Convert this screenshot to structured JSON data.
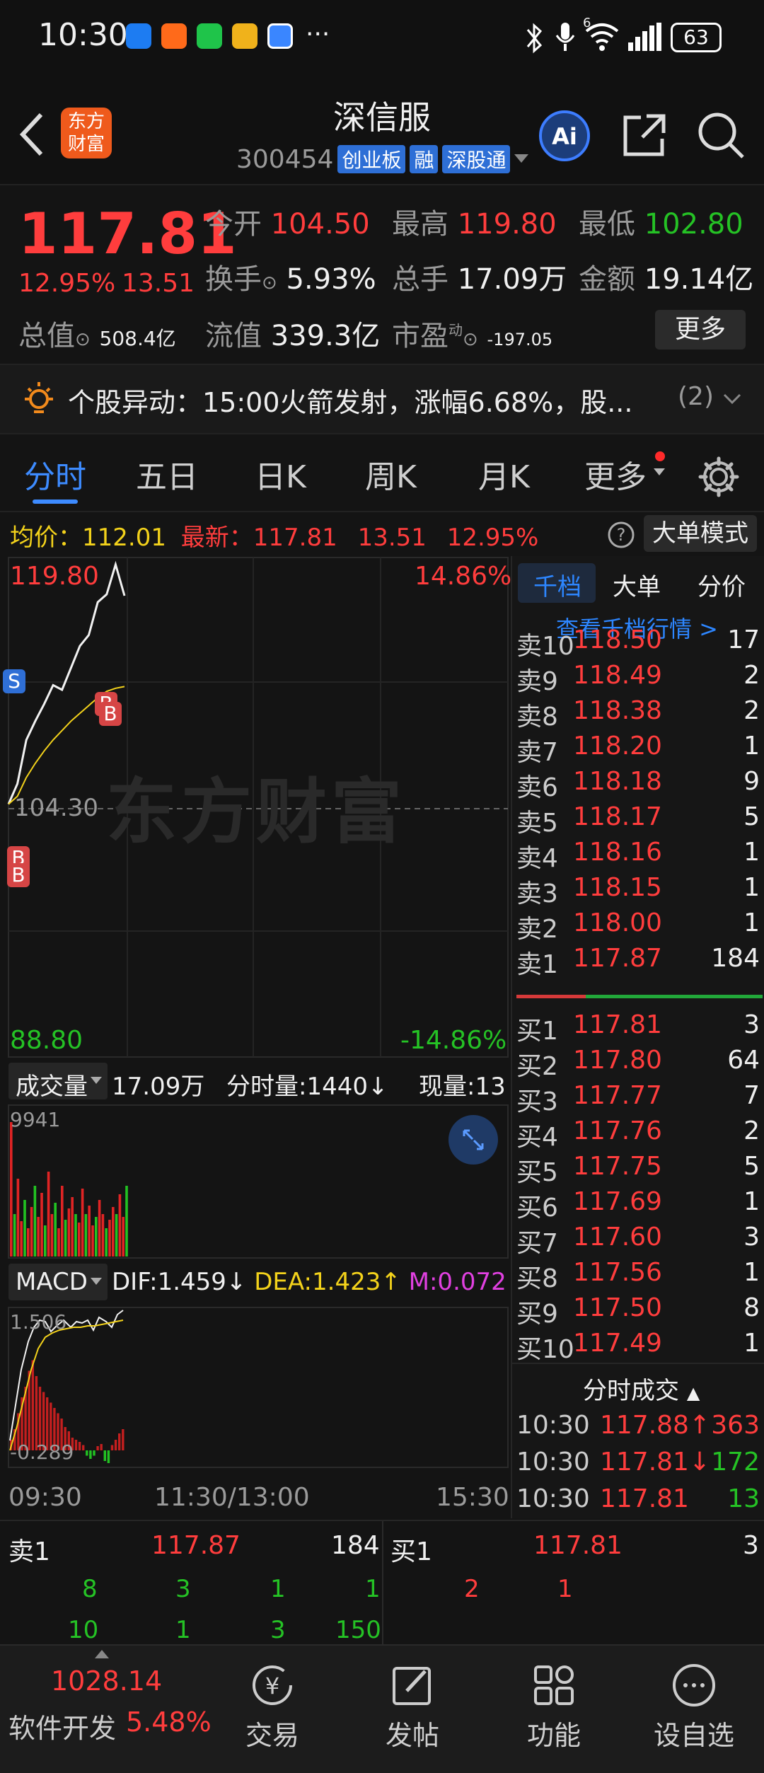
{
  "status_bar": {
    "time": "10:30",
    "more": "···",
    "signal_label": "6",
    "battery": "63"
  },
  "header": {
    "title": "深信服",
    "code": "300454",
    "tags": [
      "创业板",
      "融",
      "深股通"
    ]
  },
  "logo_text": "东方财富",
  "quote": {
    "price": "117.81",
    "change_pct": "12.95%",
    "change": "13.51",
    "fields": {
      "open_label": "今开",
      "open": "104.50",
      "high_label": "最高",
      "high": "119.80",
      "low_label": "最低",
      "low": "102.80",
      "turnover_rate_label": "换手",
      "turnover_rate": "5.93%",
      "volume_label": "总手",
      "volume": "17.09万",
      "amount_label": "金额",
      "amount": "19.14亿",
      "total_mv_label": "总值",
      "total_mv": "508.4亿",
      "float_mv_label": "流值",
      "float_mv": "339.3亿",
      "pe_label": "市盈",
      "pe_sup": "动",
      "pe": "-197.05"
    },
    "more_button": "更多"
  },
  "alert": {
    "text": "个股异动：15:00火箭发射，涨幅6.68%，股...",
    "count": "(2)"
  },
  "tabs": [
    "分时",
    "五日",
    "日K",
    "周K",
    "月K",
    "更多"
  ],
  "info_line": {
    "avg_label": "均价：",
    "avg": "112.01",
    "latest_label": "最新：",
    "latest": "117.81",
    "change": "13.51",
    "change_pct": "12.95%",
    "mode_button": "大单模式"
  },
  "chart": {
    "top_price": "119.80",
    "top_pct": "14.86%",
    "mid_price": "104.30",
    "bottom_price": "88.80",
    "bottom_pct": "-14.86%",
    "watermark": "东方财富",
    "markers": [
      "S",
      "B",
      "B",
      "B",
      "B"
    ],
    "volume_label": "成交量",
    "volume_total": "17.09万",
    "tick_volume": "分时量:1440↓",
    "current_volume": "现量:13",
    "volume_max": "9941",
    "macd_label": "MACD",
    "dif": "DIF:1.459↓",
    "dea": "DEA:1.423↑",
    "m": "M:0.072↓",
    "macd_max": "1.506",
    "macd_min": "-0.289",
    "time_labels": [
      "09:30",
      "11:30/13:00",
      "15:30"
    ]
  },
  "chart_data": {
    "type": "line",
    "title": "",
    "x": [
      "09:30",
      "09:35",
      "09:40",
      "09:45",
      "09:50",
      "09:55",
      "10:00",
      "10:05",
      "10:10",
      "10:15",
      "10:20",
      "10:25",
      "10:28",
      "10:30"
    ],
    "series": [
      {
        "name": "",
        "values": [
          104.5,
          105.8,
          108.6,
          109.8,
          110.9,
          112.1,
          111.8,
          113.2,
          114.6,
          115.3,
          117.4,
          117.9,
          119.8,
          117.81
        ]
      },
      {
        "name": "均价",
        "values": [
          104.5,
          105.0,
          106.2,
          107.1,
          107.9,
          108.6,
          109.2,
          109.8,
          110.3,
          110.8,
          111.3,
          111.7,
          111.9,
          112.01
        ]
      }
    ],
    "ylim": [
      88.8,
      119.8
    ],
    "xlabel": "",
    "ylabel": ""
  },
  "order_book": {
    "tabs": [
      "千档",
      "大单",
      "分价"
    ],
    "link": "查看千档行情 >",
    "asks": [
      {
        "label": "卖10",
        "price": "118.50",
        "vol": "17"
      },
      {
        "label": "卖9",
        "price": "118.49",
        "vol": "2"
      },
      {
        "label": "卖8",
        "price": "118.38",
        "vol": "2"
      },
      {
        "label": "卖7",
        "price": "118.20",
        "vol": "1"
      },
      {
        "label": "卖6",
        "price": "118.18",
        "vol": "9"
      },
      {
        "label": "卖5",
        "price": "118.17",
        "vol": "5"
      },
      {
        "label": "卖4",
        "price": "118.16",
        "vol": "1"
      },
      {
        "label": "卖3",
        "price": "118.15",
        "vol": "1"
      },
      {
        "label": "卖2",
        "price": "118.00",
        "vol": "1"
      },
      {
        "label": "卖1",
        "price": "117.87",
        "vol": "184"
      }
    ],
    "bids": [
      {
        "label": "买1",
        "price": "117.81",
        "vol": "3"
      },
      {
        "label": "买2",
        "price": "117.80",
        "vol": "64"
      },
      {
        "label": "买3",
        "price": "117.77",
        "vol": "7"
      },
      {
        "label": "买4",
        "price": "117.76",
        "vol": "2"
      },
      {
        "label": "买5",
        "price": "117.75",
        "vol": "5"
      },
      {
        "label": "买6",
        "price": "117.69",
        "vol": "1"
      },
      {
        "label": "买7",
        "price": "117.60",
        "vol": "3"
      },
      {
        "label": "买8",
        "price": "117.56",
        "vol": "1"
      },
      {
        "label": "买9",
        "price": "117.50",
        "vol": "8"
      },
      {
        "label": "买10",
        "price": "117.49",
        "vol": "1"
      }
    ],
    "trades_title": "分时成交",
    "trades": [
      {
        "time": "10:30",
        "price": "117.88↑",
        "vol": "363",
        "color": "#ff3d3d"
      },
      {
        "time": "10:30",
        "price": "117.81↓",
        "vol": "172",
        "color": "#25c225"
      },
      {
        "time": "10:30",
        "price": "117.81",
        "vol": "13",
        "color": "#25c225"
      }
    ]
  },
  "bottom_book": {
    "ask_label": "卖1",
    "ask_price": "117.87",
    "ask_vol": "184",
    "bid_label": "买1",
    "bid_price": "117.81",
    "bid_vol": "3",
    "ask_queue_row1": [
      "8",
      "3",
      "1",
      "1"
    ],
    "ask_queue_row2": [
      "10",
      "1",
      "3",
      "150"
    ],
    "bid_queue_row1": [
      "2",
      "1"
    ]
  },
  "nav": {
    "index_value": "1028.14",
    "index_name": "软件开发",
    "index_pct": "5.48%",
    "items": [
      "交易",
      "发帖",
      "功能",
      "设自选"
    ]
  }
}
